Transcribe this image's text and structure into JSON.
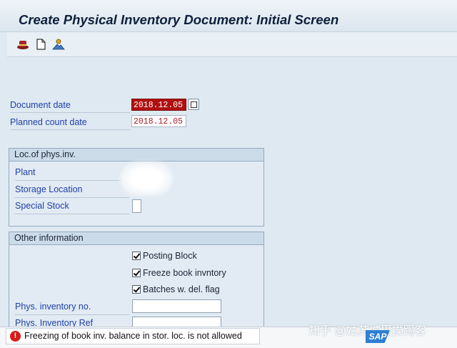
{
  "window": {
    "title": "Create Physical Inventory Document: Initial Screen"
  },
  "toolbar": {
    "icons": [
      "hat-icon",
      "new-document-icon",
      "user-mountain-icon"
    ]
  },
  "header_fields": {
    "document_date_label": "Document date",
    "document_date_value": "2018.12.05",
    "planned_count_date_label": "Planned count date",
    "planned_count_date_value": "2018.12.05"
  },
  "loc_group": {
    "title": "Loc.of phys.inv.",
    "plant_label": "Plant",
    "storage_location_label": "Storage Location",
    "special_stock_label": "Special Stock"
  },
  "other_group": {
    "title": "Other information",
    "posting_block_label": "Posting Block",
    "freeze_book_label": "Freeze book invntory",
    "batches_label": "Batches w. del. flag",
    "phys_inv_no_label": "Phys. inventory no.",
    "phys_inv_ref_label": "Phys. Inventory Ref"
  },
  "status": {
    "message": "Freezing of book inv. balance in stor. loc. is not allowed",
    "type_icon": "error-icon",
    "color": "#d61b1b"
  },
  "watermark": {
    "text": "知乎 @姑苏城里挨踢客"
  },
  "brand": {
    "logo_text": "SAP"
  }
}
